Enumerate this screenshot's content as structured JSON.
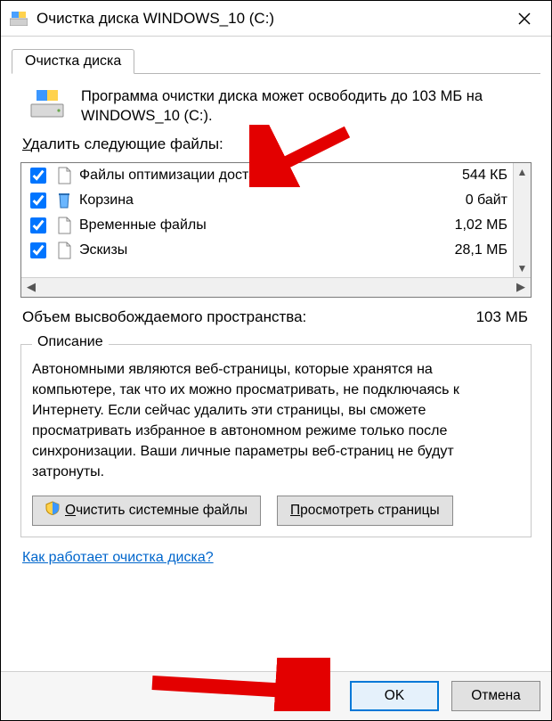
{
  "titlebar": {
    "title": "Очистка диска WINDOWS_10 (C:)"
  },
  "tab_label": "Очистка диска",
  "intro": "Программа очистки диска может освободить до 103 МБ на WINDOWS_10 (C:).",
  "files_label_pre": "",
  "files_label": "Удалить следующие файлы:",
  "files": [
    {
      "name": "Файлы оптимизации доставки",
      "size": "544 КБ",
      "checked": true,
      "icon": "file"
    },
    {
      "name": "Корзина",
      "size": "0 байт",
      "checked": true,
      "icon": "bin"
    },
    {
      "name": "Временные файлы",
      "size": "1,02 МБ",
      "checked": true,
      "icon": "file"
    },
    {
      "name": "Эскизы",
      "size": "28,1 МБ",
      "checked": true,
      "icon": "file"
    }
  ],
  "freed_label": "Объем высвобождаемого пространства:",
  "freed_value": "103 МБ",
  "group_title": "Описание",
  "description": "Автономными являются веб-страницы, которые хранятся на компьютере, так что их можно просматривать, не подключаясь к Интернету. Если сейчас удалить эти страницы, вы сможете просматривать избранное в автономном режиме только после синхронизации. Ваши личные параметры веб-страниц не будут затронуты.",
  "buttons": {
    "clean_system": "Очистить системные файлы",
    "view_pages": "Просмотреть страницы"
  },
  "help_link": "Как работает очистка диска?",
  "footer": {
    "ok": "OK",
    "cancel": "Отмена"
  }
}
